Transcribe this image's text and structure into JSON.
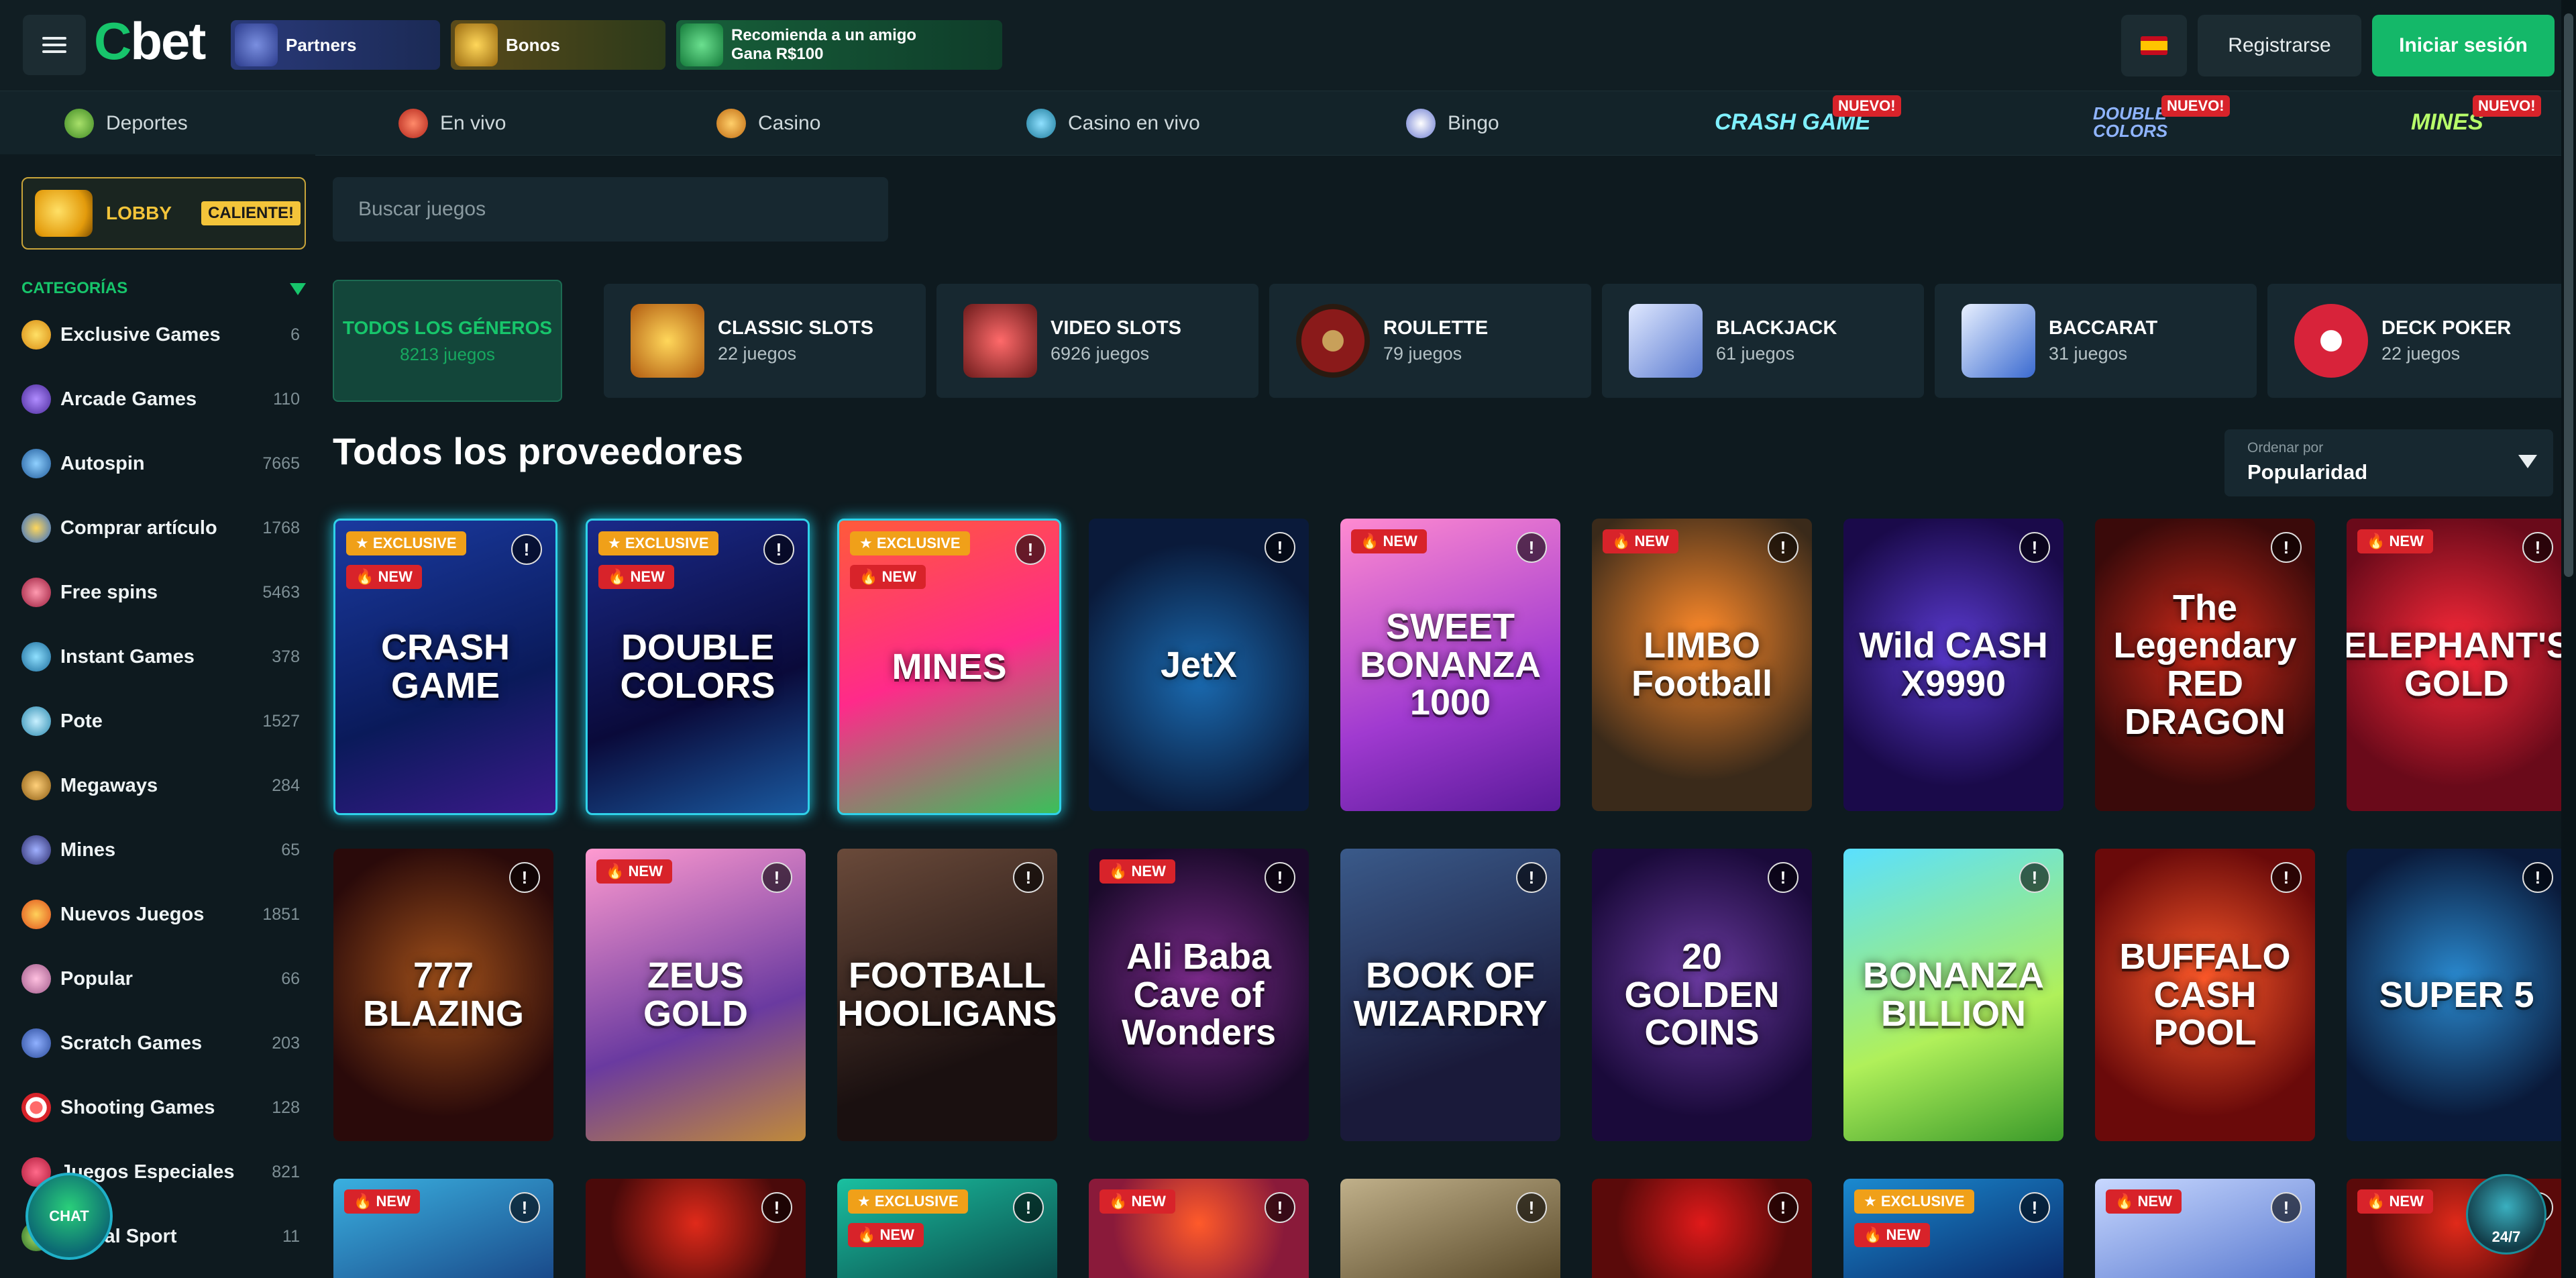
{
  "header": {
    "logo": "bet",
    "promos": [
      {
        "label": "Partners"
      },
      {
        "label": "Bonos"
      },
      {
        "line1": "Recomienda a un amigo",
        "line2": "Gana R$100"
      }
    ],
    "register_label": "Registrarse",
    "login_label": "Iniciar sesión"
  },
  "nav": {
    "items": [
      {
        "label": "Deportes"
      },
      {
        "label": "En vivo"
      },
      {
        "label": "Casino"
      },
      {
        "label": "Casino en vivo"
      },
      {
        "label": "Bingo"
      }
    ],
    "featured": [
      {
        "label": "CRASH GAME",
        "badge": "NUEVO!"
      },
      {
        "label": "DOUBLE COLORS",
        "badge": "NUEVO!"
      },
      {
        "label": "MINES",
        "badge": "NUEVO!"
      }
    ]
  },
  "sidebar": {
    "lobby_label": "LOBBY",
    "lobby_badge": "CALIENTE!",
    "categories_heading": "CATEGORÍAS",
    "categories": [
      {
        "label": "Exclusive Games",
        "count": "6"
      },
      {
        "label": "Arcade Games",
        "count": "110"
      },
      {
        "label": "Autospin",
        "count": "7665"
      },
      {
        "label": "Comprar artículo",
        "count": "1768"
      },
      {
        "label": "Free spins",
        "count": "5463"
      },
      {
        "label": "Instant Games",
        "count": "378"
      },
      {
        "label": "Pote",
        "count": "1527"
      },
      {
        "label": "Megaways",
        "count": "284"
      },
      {
        "label": "Mines",
        "count": "65"
      },
      {
        "label": "Nuevos Juegos",
        "count": "1851"
      },
      {
        "label": "Popular",
        "count": "66"
      },
      {
        "label": "Scratch Games",
        "count": "203"
      },
      {
        "label": "Shooting Games",
        "count": "128"
      },
      {
        "label": "Juegos Especiales",
        "count": "821"
      },
      {
        "label": "Virtual Sport",
        "count": "11"
      }
    ]
  },
  "search": {
    "placeholder": "Buscar juegos"
  },
  "genres": {
    "all": {
      "label": "TODOS LOS GÉNEROS",
      "sub": "8213 juegos"
    },
    "items": [
      {
        "label": "CLASSIC SLOTS",
        "sub": "22 juegos"
      },
      {
        "label": "VIDEO SLOTS",
        "sub": "6926 juegos"
      },
      {
        "label": "ROULETTE",
        "sub": "79 juegos"
      },
      {
        "label": "BLACKJACK",
        "sub": "61 juegos"
      },
      {
        "label": "BACCARAT",
        "sub": "31 juegos"
      },
      {
        "label": "DECK POKER",
        "sub": "22 juegos"
      }
    ]
  },
  "section": {
    "title": "Todos los proveedores",
    "sort_label": "Ordenar por",
    "sort_value": "Popularidad"
  },
  "games": {
    "row1": [
      {
        "title": "CRASH GAME",
        "badges": [
          "EXCLUSIVE",
          "NEW"
        ]
      },
      {
        "title": "DOUBLE COLORS",
        "badges": [
          "EXCLUSIVE",
          "NEW"
        ]
      },
      {
        "title": "MINES",
        "badges": [
          "EXCLUSIVE",
          "NEW"
        ]
      },
      {
        "title": "JetX",
        "badges": []
      },
      {
        "title": "SWEET BONANZA 1000",
        "badges": [
          "NEW"
        ]
      },
      {
        "title": "LIMBO Football",
        "badges": [
          "NEW"
        ]
      },
      {
        "title": "Wild CASH X9990",
        "badges": []
      },
      {
        "title": "The Legendary RED DRAGON",
        "badges": []
      },
      {
        "title": "ELEPHANT'S GOLD",
        "badges": [
          "NEW"
        ]
      }
    ],
    "row2": [
      {
        "title": "777 BLAZING",
        "badges": []
      },
      {
        "title": "ZEUS GOLD",
        "badges": [
          "NEW"
        ]
      },
      {
        "title": "FOOTBALL HOOLIGANS",
        "badges": []
      },
      {
        "title": "Ali Baba Cave of Wonders",
        "badges": [
          "NEW"
        ]
      },
      {
        "title": "BOOK OF WIZARDRY",
        "badges": []
      },
      {
        "title": "20 GOLDEN COINS",
        "badges": []
      },
      {
        "title": "BONANZA BILLION",
        "badges": []
      },
      {
        "title": "BUFFALO CASH POOL",
        "badges": []
      },
      {
        "title": "SUPER 5",
        "badges": []
      }
    ],
    "row3_badges": [
      [
        "NEW"
      ],
      [],
      [
        "EXCLUSIVE",
        "NEW"
      ],
      [
        "NEW"
      ],
      [],
      [],
      [
        "EXCLUSIVE",
        "NEW"
      ],
      [
        "NEW"
      ],
      [
        "NEW"
      ]
    ],
    "info_icon": "!"
  },
  "chat_label": "CHAT",
  "support_label": "24/7",
  "colors": {
    "background": "#0e1a1f",
    "accent_green": "#14b869",
    "new_badge": "#d8232a",
    "exclusive_badge": "#f0a019",
    "glow": "#2fd2e9"
  }
}
